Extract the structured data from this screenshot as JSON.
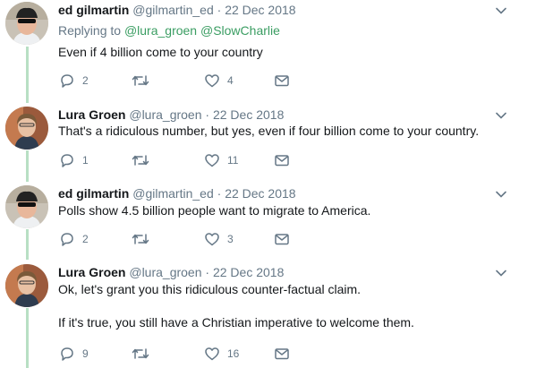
{
  "tweets": [
    {
      "name": "ed gilmartin",
      "handle": "@gilmartin_ed",
      "separator": "·",
      "date": "22 Dec 2018",
      "replying_prefix": "Replying to",
      "replying_to": [
        "@lura_groen",
        "@SlowCharlie"
      ],
      "text_lines": [
        "Even if 4 billion come to your country"
      ],
      "counts": {
        "replies": "2",
        "retweets": "",
        "likes": "4"
      }
    },
    {
      "name": "Lura Groen",
      "handle": "@lura_groen",
      "separator": "·",
      "date": "22 Dec 2018",
      "text_lines": [
        "That's a ridiculous number, but yes, even if four billion come to your country."
      ],
      "counts": {
        "replies": "1",
        "retweets": "",
        "likes": "11"
      }
    },
    {
      "name": "ed gilmartin",
      "handle": "@gilmartin_ed",
      "separator": "·",
      "date": "22 Dec 2018",
      "text_lines": [
        "Polls show 4.5 billion people want to migrate to America."
      ],
      "counts": {
        "replies": "2",
        "retweets": "",
        "likes": "3"
      }
    },
    {
      "name": "Lura Groen",
      "handle": "@lura_groen",
      "separator": "·",
      "date": "22 Dec 2018",
      "text_lines": [
        "Ok, let's grant you this ridiculous counter-factual claim.",
        "If it's true, you still have a Christian imperative to welcome them."
      ],
      "counts": {
        "replies": "9",
        "retweets": "",
        "likes": "16"
      }
    }
  ],
  "colors": {
    "thread_line": "#b8dfc4",
    "mention": "#3a9d62",
    "muted": "#657786"
  },
  "icons": [
    "reply-icon",
    "retweet-icon",
    "like-icon",
    "direct-message-icon",
    "chevron-down-icon"
  ]
}
